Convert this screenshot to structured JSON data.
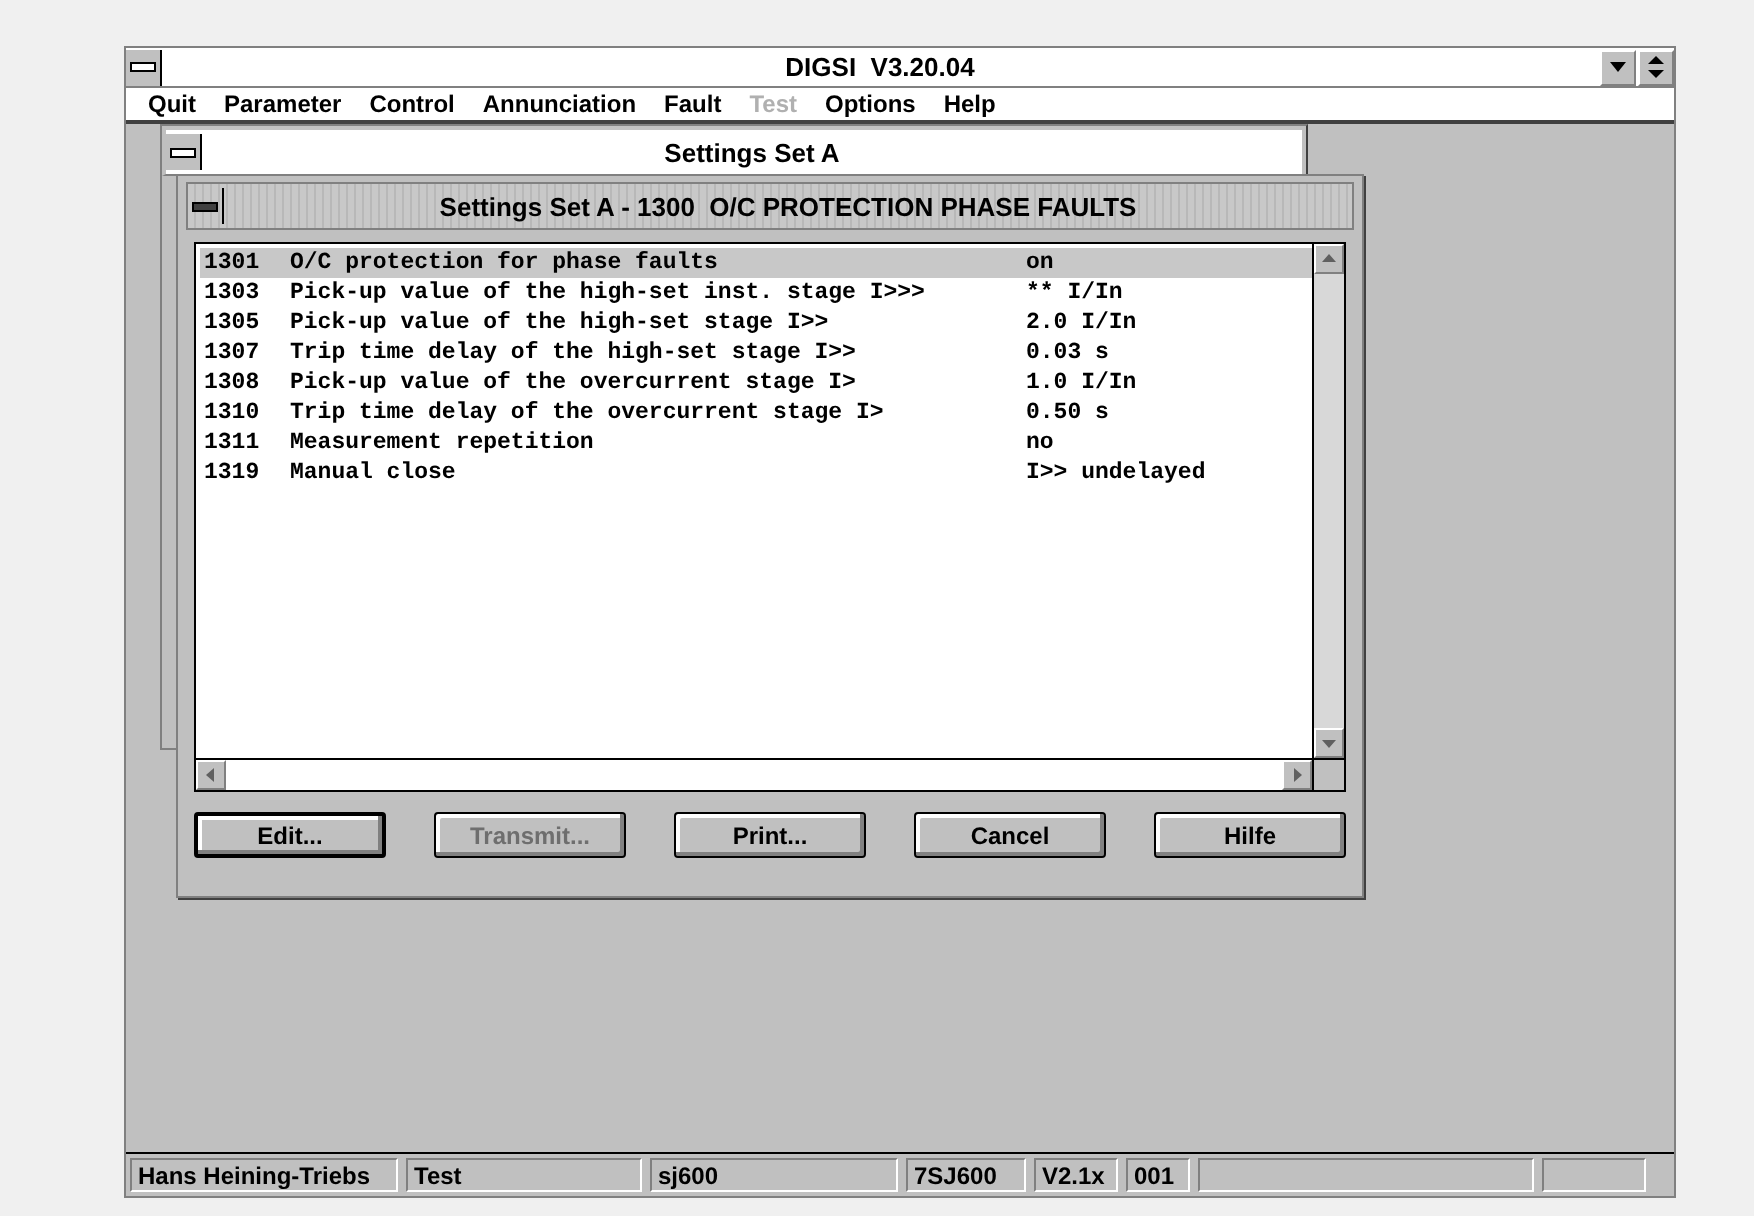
{
  "window": {
    "title": "DIGSI  V3.20.04"
  },
  "menu": [
    {
      "label": "Quit",
      "disabled": false
    },
    {
      "label": "Parameter",
      "disabled": false
    },
    {
      "label": "Control",
      "disabled": false
    },
    {
      "label": "Annunciation",
      "disabled": false
    },
    {
      "label": "Fault",
      "disabled": false
    },
    {
      "label": "Test",
      "disabled": true
    },
    {
      "label": "Options",
      "disabled": false
    },
    {
      "label": "Help",
      "disabled": false
    }
  ],
  "child_window": {
    "title": "Settings Set A"
  },
  "dialog": {
    "title": "Settings Set A - 1300  O/C PROTECTION PHASE FAULTS",
    "rows": [
      {
        "number": "1301",
        "label": "O/C protection for phase faults",
        "value": "on",
        "selected": true
      },
      {
        "number": "1303",
        "label": "Pick-up value of the high-set inst. stage I>>>",
        "value": "** I/In",
        "selected": false
      },
      {
        "number": "1305",
        "label": "Pick-up value of the high-set stage I>>",
        "value": "2.0 I/In",
        "selected": false
      },
      {
        "number": "1307",
        "label": "Trip time delay of the high-set stage I>>",
        "value": "0.03 s",
        "selected": false
      },
      {
        "number": "1308",
        "label": "Pick-up value of the overcurrent stage I>",
        "value": "1.0 I/In",
        "selected": false
      },
      {
        "number": "1310",
        "label": "Trip time delay of the overcurrent stage I>",
        "value": "0.50 s",
        "selected": false
      },
      {
        "number": "1311",
        "label": "Measurement repetition",
        "value": "no",
        "selected": false
      },
      {
        "number": "1319",
        "label": "Manual close",
        "value": "I>> undelayed",
        "selected": false
      }
    ],
    "buttons": [
      {
        "label": "Edit...",
        "disabled": false,
        "default": true
      },
      {
        "label": "Transmit...",
        "disabled": true,
        "default": false
      },
      {
        "label": "Print...",
        "disabled": false,
        "default": false
      },
      {
        "label": "Cancel",
        "disabled": false,
        "default": false
      },
      {
        "label": "Hilfe",
        "disabled": false,
        "default": false
      }
    ]
  },
  "status_bar": [
    "Hans Heining-Triebs",
    "Test",
    "sj600",
    "7SJ600",
    "V2.1x",
    "001"
  ]
}
